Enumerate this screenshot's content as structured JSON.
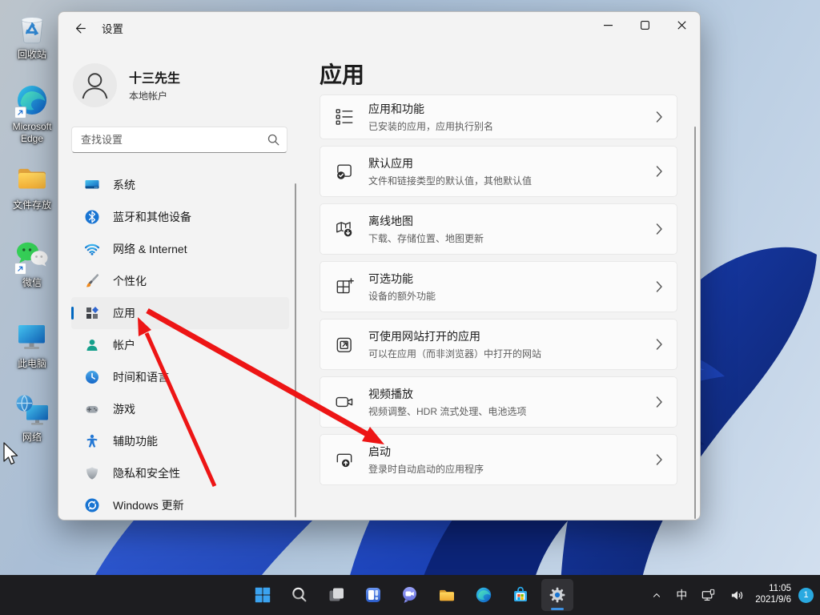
{
  "desktop": {
    "icons": [
      {
        "label": "回收站",
        "icon": "recycle-bin",
        "shortcut": false
      },
      {
        "label": "Microsoft Edge",
        "icon": "edge-desktop",
        "shortcut": true
      },
      {
        "label": "文件存放",
        "icon": "folder-desktop",
        "shortcut": false
      },
      {
        "label": "微信",
        "icon": "wechat",
        "shortcut": true
      },
      {
        "label": "此电脑",
        "icon": "this-pc",
        "shortcut": false
      },
      {
        "label": "网络",
        "icon": "network-desktop",
        "shortcut": false
      }
    ]
  },
  "window": {
    "title": "设置",
    "titlebar_icons": [
      "back-arrow-icon",
      "minimize-icon",
      "maximize-icon",
      "close-icon"
    ],
    "user": {
      "name": "十三先生",
      "type": "本地帐户"
    },
    "search": {
      "placeholder": "查找设置",
      "icon": "search-icon"
    },
    "sidebar": {
      "items": [
        {
          "label": "系统",
          "icon": "system",
          "selected": false
        },
        {
          "label": "蓝牙和其他设备",
          "icon": "bluetooth",
          "selected": false
        },
        {
          "label": "网络 & Internet",
          "icon": "network-internet",
          "selected": false
        },
        {
          "label": "个性化",
          "icon": "personalization",
          "selected": false
        },
        {
          "label": "应用",
          "icon": "apps",
          "selected": true
        },
        {
          "label": "帐户",
          "icon": "accounts",
          "selected": false
        },
        {
          "label": "时间和语言",
          "icon": "time-language",
          "selected": false
        },
        {
          "label": "游戏",
          "icon": "gaming",
          "selected": false
        },
        {
          "label": "辅助功能",
          "icon": "accessibility",
          "selected": false
        },
        {
          "label": "隐私和安全性",
          "icon": "privacy",
          "selected": false
        },
        {
          "label": "Windows 更新",
          "icon": "windows-update",
          "selected": false
        }
      ]
    },
    "page": {
      "title": "应用",
      "items": [
        {
          "title": "应用和功能",
          "subtitle": "已安装的应用，应用执行别名",
          "icon": "apps-features"
        },
        {
          "title": "默认应用",
          "subtitle": "文件和链接类型的默认值，其他默认值",
          "icon": "default-apps"
        },
        {
          "title": "离线地图",
          "subtitle": "下载、存储位置、地图更新",
          "icon": "offline-maps"
        },
        {
          "title": "可选功能",
          "subtitle": "设备的额外功能",
          "icon": "optional-features"
        },
        {
          "title": "可使用网站打开的应用",
          "subtitle": "可以在应用（而非浏览器）中打开的网站",
          "icon": "web-apps"
        },
        {
          "title": "视频播放",
          "subtitle": "视频调整、HDR 流式处理、电池选项",
          "icon": "video-playback"
        },
        {
          "title": "启动",
          "subtitle": "登录时自动启动的应用程序",
          "icon": "startup"
        }
      ]
    }
  },
  "annotations": {
    "arrow_color": "#ed1515",
    "arrows": [
      {
        "points_to": "sidebar-item-apps"
      },
      {
        "points_to": "card-startup"
      }
    ]
  },
  "taskbar": {
    "buttons": [
      {
        "name": "start",
        "active": false
      },
      {
        "name": "search",
        "active": false
      },
      {
        "name": "task-view",
        "active": false
      },
      {
        "name": "widgets",
        "active": false
      },
      {
        "name": "chat",
        "active": false
      },
      {
        "name": "file-explorer",
        "active": false
      },
      {
        "name": "edge-taskbar",
        "active": false
      },
      {
        "name": "store",
        "active": false
      },
      {
        "name": "settings",
        "active": true
      }
    ],
    "tray": {
      "ime": "中",
      "icons": [
        "chevron-up-icon",
        "network-tray-icon",
        "volume-icon"
      ],
      "time": "11:05",
      "date": "2021/9/6",
      "badge": "1"
    }
  },
  "colors": {
    "accent": "#0067c0",
    "selection_bg": "#ededed",
    "taskbar_bg": "#1d1d20",
    "window_bg": "#f3f3f3",
    "card_bg": "#fbfbfb",
    "arrow_red": "#ed1515"
  }
}
